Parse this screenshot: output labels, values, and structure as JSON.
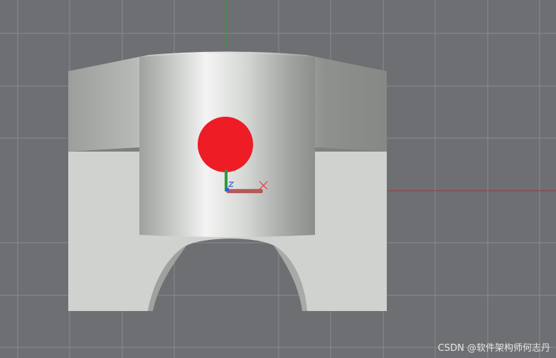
{
  "viewport": {
    "background": "#6e6f72",
    "grid_color": "#8a8b8e"
  },
  "axes": {
    "x_axis_color": "#b23a3a",
    "y_axis_color": "#2e9a3a",
    "z_axis_color": "#3a5fd0",
    "gizmo_icon": "xyz-axis-gizmo-icon"
  },
  "model": {
    "body_color": "#d0d2cf",
    "shade_color": "#8d8f8c"
  },
  "marker": {
    "color": "#ee1c25"
  },
  "watermark": {
    "text": "CSDN @软件架构师何志丹"
  }
}
